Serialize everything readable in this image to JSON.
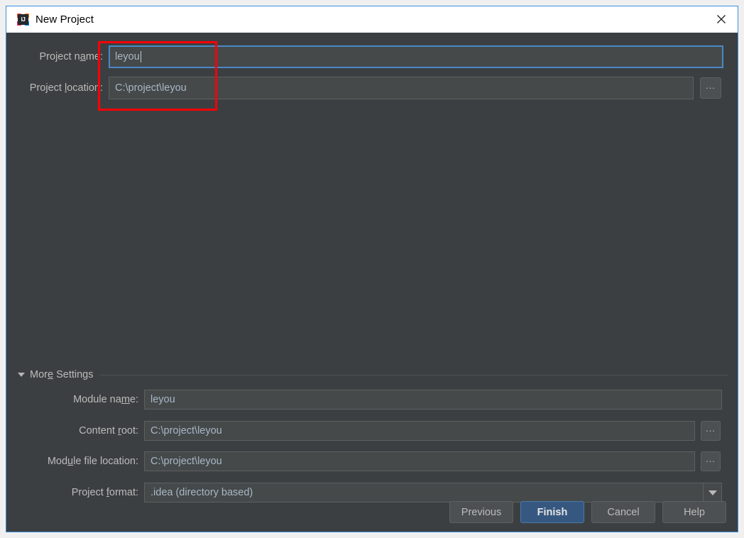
{
  "window": {
    "title": "New Project",
    "app_icon": "intellij-idea-icon",
    "icon_text": "IJ",
    "close_icon": "close-icon"
  },
  "form": {
    "project_name": {
      "label_pre": "Project n",
      "label_mnemonic": "a",
      "label_post": "me:",
      "value": "leyou",
      "focused": true
    },
    "project_location": {
      "label_pre": "Project ",
      "label_mnemonic": "l",
      "label_post": "ocation:",
      "value": "C:\\project\\leyou",
      "browse_label": "..."
    }
  },
  "annotation": {
    "type": "red-rectangle-highlight",
    "color": "#fb0007"
  },
  "more_settings": {
    "expanded": true,
    "header": {
      "label_pre": "Mor",
      "label_mnemonic": "e",
      "label_post": " Settings",
      "collapse_icon": "triangle-down-icon"
    },
    "rows": [
      {
        "label_pre": "Module na",
        "label_mnemonic": "m",
        "label_post": "e:",
        "value": "leyou",
        "control": "text",
        "browse": false
      },
      {
        "label_pre": "Content ",
        "label_mnemonic": "r",
        "label_post": "oot:",
        "value": "C:\\project\\leyou",
        "control": "text",
        "browse": true,
        "browse_label": "..."
      },
      {
        "label_pre": "Mod",
        "label_mnemonic": "u",
        "label_post": "le file location:",
        "value": "C:\\project\\leyou",
        "control": "text",
        "browse": true,
        "browse_label": "..."
      },
      {
        "label_pre": "Project ",
        "label_mnemonic": "f",
        "label_post": "ormat:",
        "value": ".idea (directory based)",
        "control": "combo",
        "arrow_icon": "chevron-down-icon",
        "browse": false
      }
    ]
  },
  "buttons": {
    "previous": "Previous",
    "finish": "Finish",
    "cancel": "Cancel",
    "help": "Help",
    "default": "Finish"
  },
  "colors": {
    "dialog_bg": "#3c3f41",
    "field_bg": "#45494a",
    "field_border": "#5e6060",
    "text": "#bbbbbb",
    "value_text": "#a9b7c6",
    "focus_border": "#4a88c7",
    "primary_button": "#365880",
    "window_border": "#3c8fdb",
    "annotation": "#fb0007"
  }
}
